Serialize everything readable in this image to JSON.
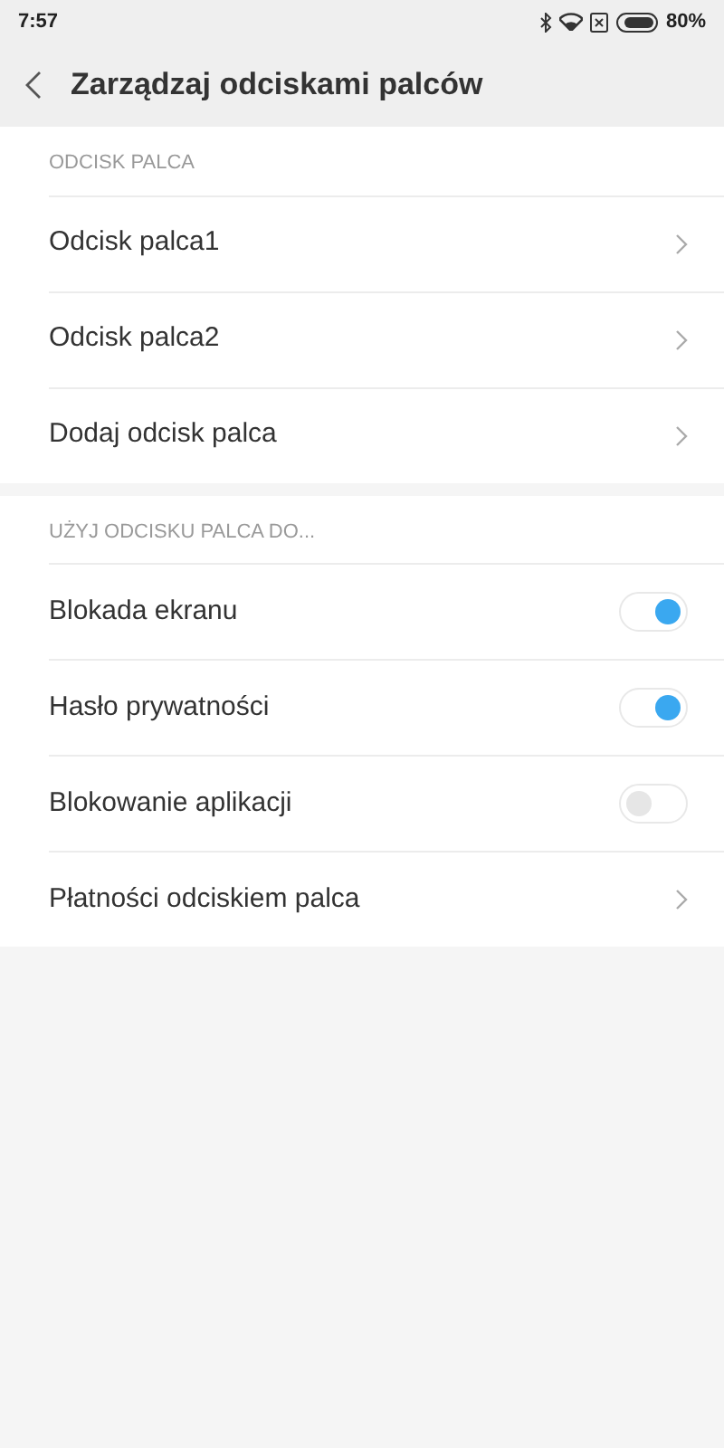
{
  "status_bar": {
    "time": "7:57",
    "battery": "80%"
  },
  "header": {
    "title": "Zarządzaj odciskami palców"
  },
  "sections": [
    {
      "title": "ODCISK PALCA",
      "items": [
        {
          "kind": "link",
          "label": "Odcisk palca1"
        },
        {
          "kind": "link",
          "label": "Odcisk palca2"
        },
        {
          "kind": "link",
          "label": "Dodaj odcisk palca"
        }
      ]
    },
    {
      "title": "UŻYJ ODCISKU PALCA DO...",
      "items": [
        {
          "kind": "toggle",
          "label": "Blokada ekranu",
          "on": true
        },
        {
          "kind": "toggle",
          "label": "Hasło prywatności",
          "on": true
        },
        {
          "kind": "toggle",
          "label": "Blokowanie aplikacji",
          "on": false
        },
        {
          "kind": "link",
          "label": "Płatności odciskiem palca"
        }
      ]
    }
  ]
}
